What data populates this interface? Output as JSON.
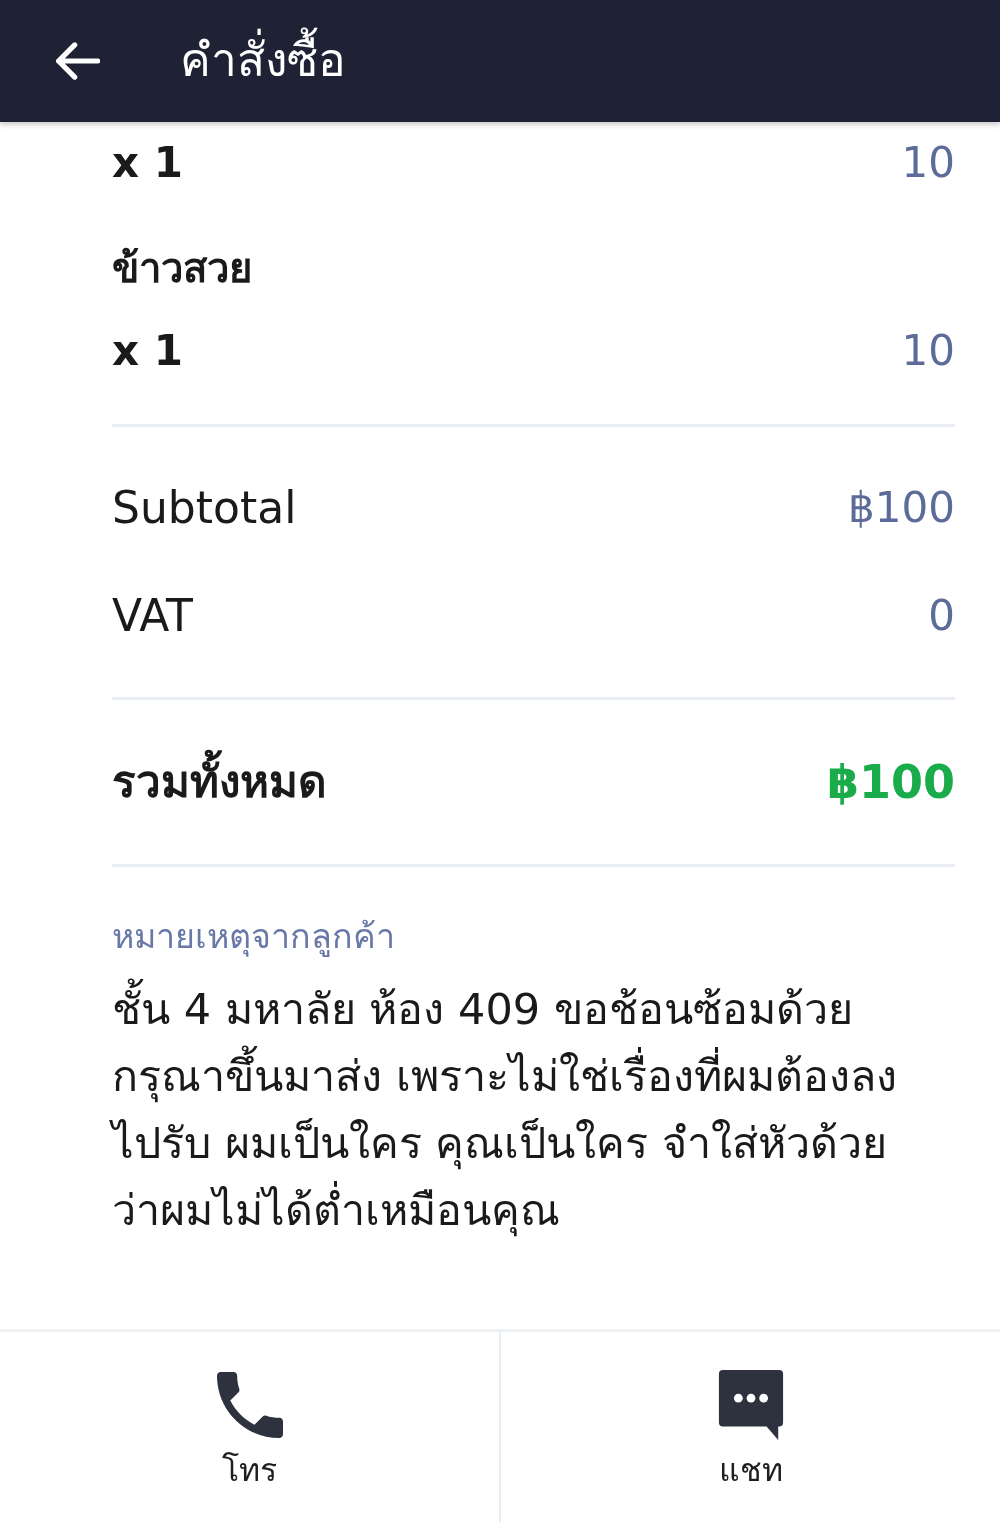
{
  "header": {
    "title": "คำสั่งซื้อ"
  },
  "items": [
    {
      "quantity": "x 1",
      "price": "10"
    },
    {
      "name": "ข้าวสวย",
      "quantity": "x 1",
      "price": "10"
    }
  ],
  "summary": [
    {
      "label": "Subtotal",
      "value": "฿100"
    },
    {
      "label": "VAT",
      "value": "0"
    }
  ],
  "total": {
    "label": "รวมทั้งหมด",
    "value": "฿100"
  },
  "note": {
    "label": "หมายเหตุจากลูกค้า",
    "text": "ชั้น 4 มหาลัย ห้อง 409 ขอช้อนซ้อมด้วย กรุณาขึ้นมาส่ง เพราะไม่ใช่เรื่องที่ผมต้องลงไปรับ ผมเป็นใคร คุณเป็นใคร จำใส่หัวด้วยว่าผมไม่ได้ต่ำเหมือนคุณ"
  },
  "actions": [
    {
      "kind": "call",
      "label": "โทร"
    },
    {
      "kind": "chat",
      "label": "แชท"
    }
  ]
}
